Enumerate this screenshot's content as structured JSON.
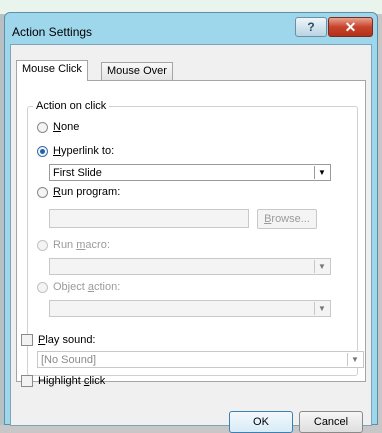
{
  "window": {
    "title": "Action Settings",
    "help_glyph": "?",
    "close_glyph": "✕"
  },
  "tabs": [
    {
      "label": "Mouse Click",
      "active": true
    },
    {
      "label": "Mouse Over",
      "active": false
    }
  ],
  "action_group": {
    "legend": "Action on click",
    "options": {
      "none": {
        "pre": "",
        "key": "N",
        "post": "one",
        "checked": false,
        "enabled": true
      },
      "hyperlink": {
        "pre": "",
        "key": "H",
        "post": "yperlink to:",
        "checked": true,
        "enabled": true
      },
      "run_program": {
        "pre": "",
        "key": "R",
        "post": "un program:",
        "checked": false,
        "enabled": true
      },
      "run_macro": {
        "pre": "Run ",
        "key": "m",
        "post": "acro:",
        "checked": false,
        "enabled": false
      },
      "object_action": {
        "pre": "Object ",
        "key": "a",
        "post": "ction:",
        "checked": false,
        "enabled": false
      }
    },
    "hyperlink_value": "First Slide",
    "program_value": "",
    "browse": {
      "key": "B",
      "post": "rowse..."
    },
    "macro_value": "",
    "object_value": ""
  },
  "play_sound": {
    "pre": "",
    "key": "P",
    "post": "lay sound:",
    "checked": false,
    "value": "[No Sound]"
  },
  "highlight_click": {
    "pre": "Highlight ",
    "key": "c",
    "post": "lick",
    "checked": false
  },
  "buttons": {
    "ok": "OK",
    "cancel": "Cancel"
  }
}
